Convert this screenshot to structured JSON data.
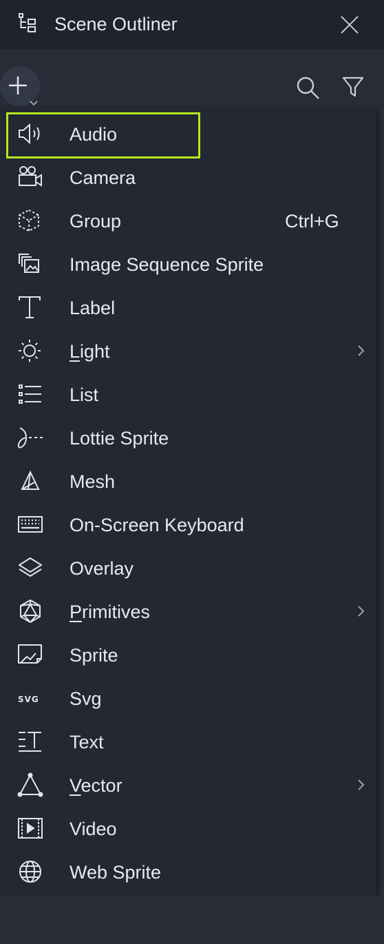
{
  "window": {
    "title": "Scene Outliner"
  },
  "menu": {
    "items": [
      {
        "label": "Audio",
        "icon": "speaker-icon"
      },
      {
        "label": "Camera",
        "icon": "camera-icon"
      },
      {
        "label": "Group",
        "icon": "group-icon",
        "shortcut": "Ctrl+G"
      },
      {
        "label": "Image Sequence Sprite",
        "icon": "image-sequence-icon"
      },
      {
        "label": "Label",
        "icon": "text-t-icon"
      },
      {
        "label_first": "L",
        "label_rest": "ight",
        "label": "Light",
        "icon": "sun-icon",
        "submenu": true
      },
      {
        "label": "List",
        "icon": "list-icon"
      },
      {
        "label": "Lottie Sprite",
        "icon": "lottie-icon"
      },
      {
        "label": "Mesh",
        "icon": "mesh-icon"
      },
      {
        "label": "On-Screen Keyboard",
        "icon": "keyboard-icon"
      },
      {
        "label": "Overlay",
        "icon": "layers-icon"
      },
      {
        "label_first": "P",
        "label_rest": "rimitives",
        "label": "Primitives",
        "icon": "polyhedron-icon",
        "submenu": true
      },
      {
        "label": "Sprite",
        "icon": "sprite-icon"
      },
      {
        "label": "Svg",
        "icon": "svg-icon",
        "icon_text": "SVG"
      },
      {
        "label": "Text",
        "icon": "text-lines-icon"
      },
      {
        "label_first": "V",
        "label_rest": "ector",
        "label": "Vector",
        "icon": "vector-triangle-icon",
        "submenu": true
      },
      {
        "label": "Video",
        "icon": "video-icon"
      },
      {
        "label": "Web Sprite",
        "icon": "globe-icon"
      }
    ],
    "highlighted": "Audio"
  },
  "colors": {
    "accent_highlight": "#b5e61d",
    "menu_bg": "#232833",
    "titlebar_bg": "#1f232b"
  }
}
